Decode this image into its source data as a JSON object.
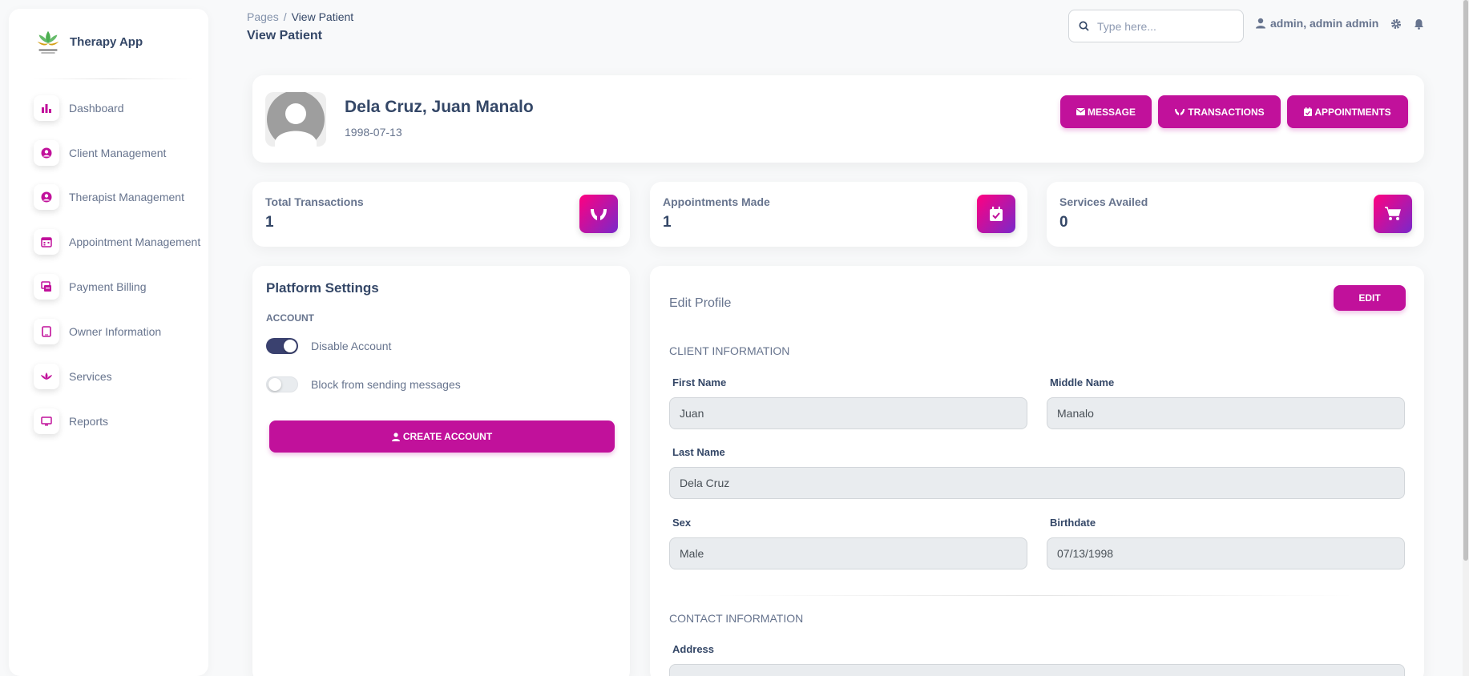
{
  "brand": {
    "name": "Therapy App"
  },
  "sidebar": {
    "items": [
      {
        "label": "Dashboard",
        "icon": "bar-chart-icon"
      },
      {
        "label": "Client Management",
        "icon": "user-circle-icon"
      },
      {
        "label": "Therapist Management",
        "icon": "user-circle-icon"
      },
      {
        "label": "Appointment Management",
        "icon": "calendar-icon"
      },
      {
        "label": "Payment Billing",
        "icon": "billing-icon"
      },
      {
        "label": "Owner Information",
        "icon": "tablet-icon"
      },
      {
        "label": "Services",
        "icon": "lotus-icon"
      },
      {
        "label": "Reports",
        "icon": "monitor-icon"
      }
    ]
  },
  "header": {
    "breadcrumb": {
      "root": "Pages",
      "separator": "/",
      "current": "View Patient"
    },
    "title": "View Patient",
    "search_placeholder": "Type here...",
    "user": "admin, admin admin"
  },
  "profile": {
    "name": "Dela Cruz, Juan Manalo",
    "birthdate": "1998-07-13",
    "buttons": {
      "message": "MESSAGE",
      "transactions": "TRANSACTIONS",
      "appointments": "APPOINTMENTS"
    }
  },
  "stats": [
    {
      "label": "Total Transactions",
      "value": "1",
      "icon": "hands-icon"
    },
    {
      "label": "Appointments Made",
      "value": "1",
      "icon": "calendar-check-icon"
    },
    {
      "label": "Services Availed",
      "value": "0",
      "icon": "cart-icon"
    }
  ],
  "settings": {
    "title": "Platform Settings",
    "section": "ACCOUNT",
    "toggles": [
      {
        "label": "Disable Account",
        "on": true
      },
      {
        "label": "Block from sending messages",
        "on": false
      }
    ],
    "create_button": "CREATE ACCOUNT"
  },
  "edit_profile": {
    "title": "Edit Profile",
    "edit_button": "EDIT",
    "client_section": "CLIENT INFORMATION",
    "contact_section": "CONTACT INFORMATION",
    "fields": {
      "first_name": {
        "label": "First Name",
        "value": "Juan"
      },
      "middle_name": {
        "label": "Middle Name",
        "value": "Manalo"
      },
      "last_name": {
        "label": "Last Name",
        "value": "Dela Cruz"
      },
      "sex": {
        "label": "Sex",
        "value": "Male"
      },
      "birthdate": {
        "label": "Birthdate",
        "value": "07/13/1998"
      },
      "address": {
        "label": "Address",
        "value": ""
      }
    }
  },
  "colors": {
    "accent": "#c1119b",
    "text": "#344767",
    "muted": "#67748e",
    "toggle_on": "#3a416f"
  }
}
